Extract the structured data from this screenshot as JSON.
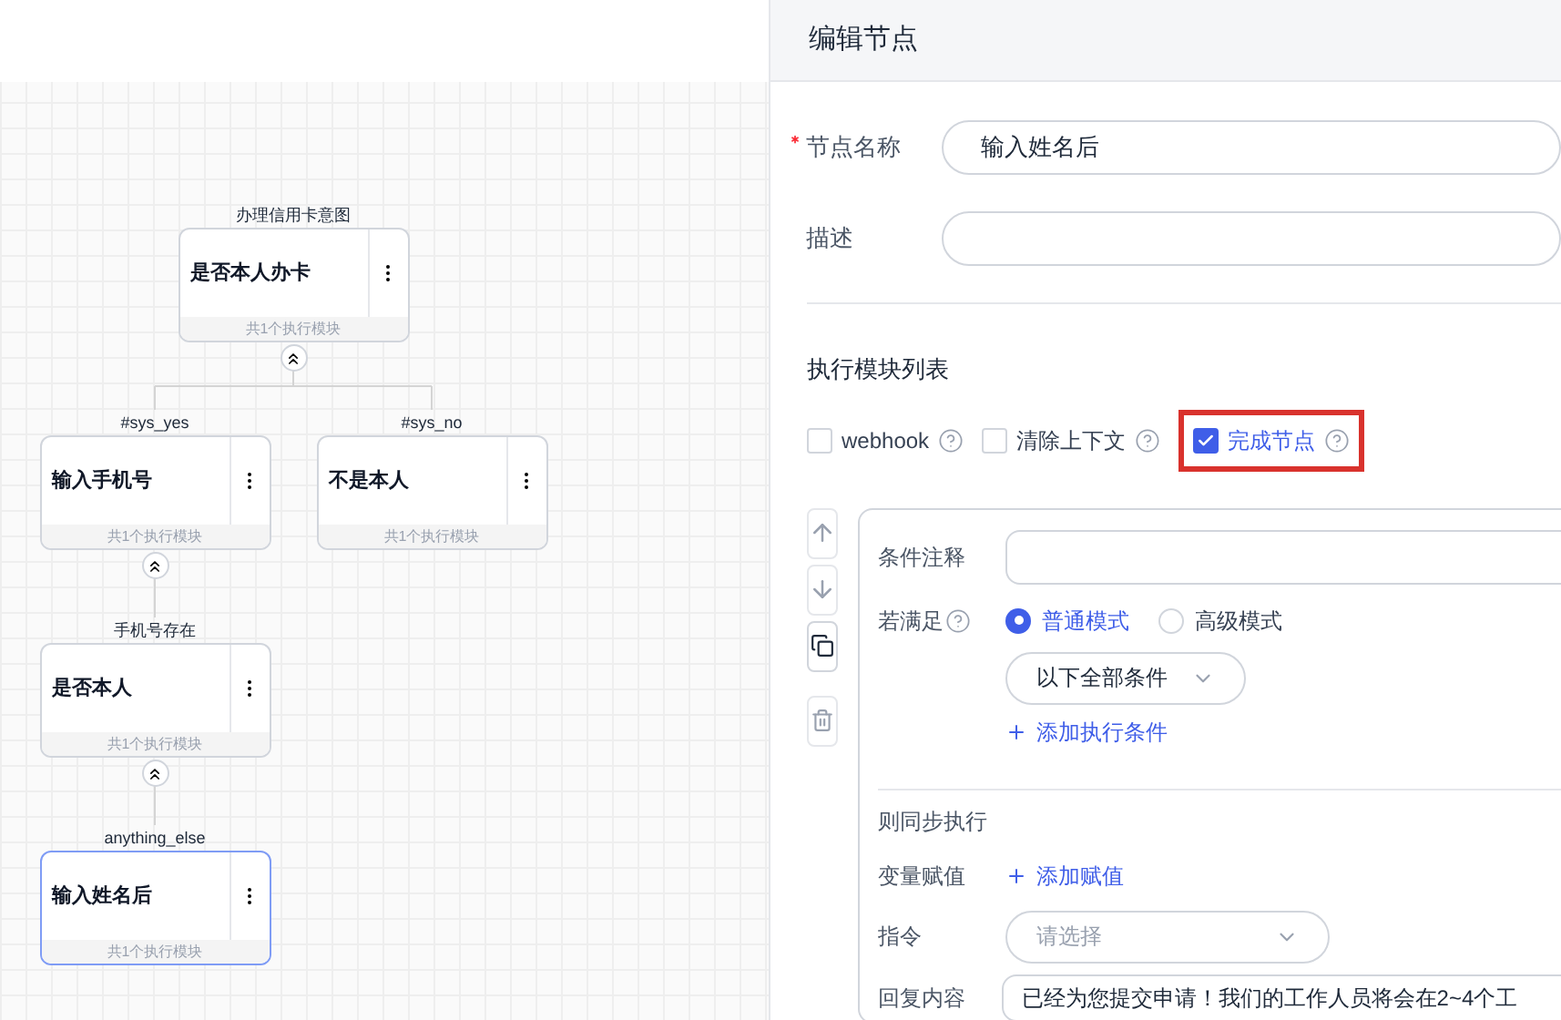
{
  "flow": {
    "nodes": [
      {
        "label": "办理信用卡意图",
        "title": "是否本人办卡",
        "footer": "共1个执行模块",
        "selected": false,
        "children": [
          {
            "label": "#sys_yes",
            "title": "输入手机号",
            "footer": "共1个执行模块",
            "selected": false,
            "children": [
              {
                "label": "手机号存在",
                "title": "是否本人",
                "footer": "共1个执行模块",
                "selected": false,
                "children": [
                  {
                    "label": "anything_else",
                    "title": "输入姓名后",
                    "footer": "共1个执行模块",
                    "selected": true
                  }
                ]
              }
            ]
          },
          {
            "label": "#sys_no",
            "title": "不是本人",
            "footer": "共1个执行模块",
            "selected": false
          }
        ]
      }
    ]
  },
  "panel": {
    "title": "编辑节点",
    "fields": [
      {
        "label": "节点名称",
        "required": true,
        "value": "输入姓名后"
      },
      {
        "label": "描述",
        "required": false
      }
    ],
    "modules": {
      "title": "执行模块列表",
      "options": [
        {
          "label": "webhook",
          "checked": false,
          "highlighted": false
        },
        {
          "label": "清除上下文",
          "checked": false,
          "highlighted": false
        },
        {
          "label": "完成节点",
          "checked": true,
          "highlighted": true
        }
      ]
    },
    "block": {
      "comment_label": "条件注释",
      "condition": {
        "label": "若满足",
        "modes": [
          {
            "label": "普通模式",
            "selected": true
          },
          {
            "label": "高级模式",
            "selected": false
          }
        ],
        "match": "以下全部条件",
        "add_condition": "添加执行条件"
      },
      "then_title": "则同步执行",
      "assign": {
        "label": "变量赋值",
        "action": "添加赋值"
      },
      "command": {
        "label": "指令",
        "placeholder": "请选择"
      },
      "reply": {
        "label": "回复内容",
        "value": "已经为您提交申请！我们的工作人员将会在2~4个工"
      }
    }
  }
}
